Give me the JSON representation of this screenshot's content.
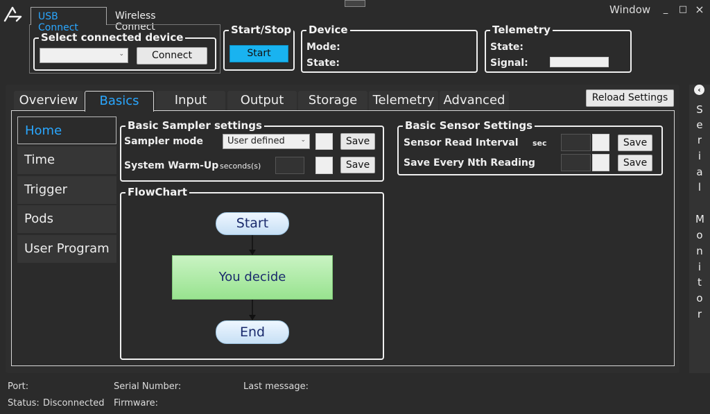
{
  "window": {
    "title": "Window",
    "minimize": "_",
    "maximize": "□",
    "close": "×"
  },
  "connection": {
    "tabs": [
      "USB Connect",
      "Wireless Connect"
    ],
    "select_title": "Select connected device",
    "device_value": "",
    "connect_label": "Connect"
  },
  "startstop": {
    "title": "Start/Stop",
    "button": "Start"
  },
  "device": {
    "title": "Device",
    "mode_label": "Mode:",
    "state_label": "State:"
  },
  "telemetry": {
    "title": "Telemetry",
    "state_label": "State:",
    "signal_label": "Signal:",
    "signal_value": ""
  },
  "reload_label": "Reload Settings",
  "main_tabs": [
    "Overview",
    "Basics",
    "Input",
    "Output",
    "Storage",
    "Telemetry",
    "Advanced"
  ],
  "side_nav": [
    "Home",
    "Time",
    "Trigger",
    "Pods",
    "User Program"
  ],
  "sampler": {
    "title": "Basic Sampler settings",
    "mode_label": "Sampler mode",
    "mode_value": "User defined",
    "warmup_label": "System Warm-Up",
    "warmup_unit": "seconds(s)",
    "save": "Save"
  },
  "sensor": {
    "title": "Basic Sensor Settings",
    "interval_label": "Sensor Read Interval",
    "interval_unit": "sec",
    "nth_label": "Save Every Nth Reading",
    "save": "Save"
  },
  "flowchart": {
    "title": "FlowChart",
    "start": "Start",
    "middle": "You decide",
    "end": "End"
  },
  "serial_monitor": [
    "S",
    "e",
    "r",
    "i",
    "a",
    "l",
    "M",
    "o",
    "n",
    "i",
    "t",
    "o",
    "r"
  ],
  "status": {
    "port": "Port:",
    "status_label": "Status:",
    "status_value": "Disconnected",
    "serial_number": "Serial Number:",
    "firmware": "Firmware:",
    "last_message": "Last message:"
  },
  "colors": {
    "accent": "#2aa7ff",
    "start_button": "#19b3f0",
    "background": "#2b2b2b"
  }
}
